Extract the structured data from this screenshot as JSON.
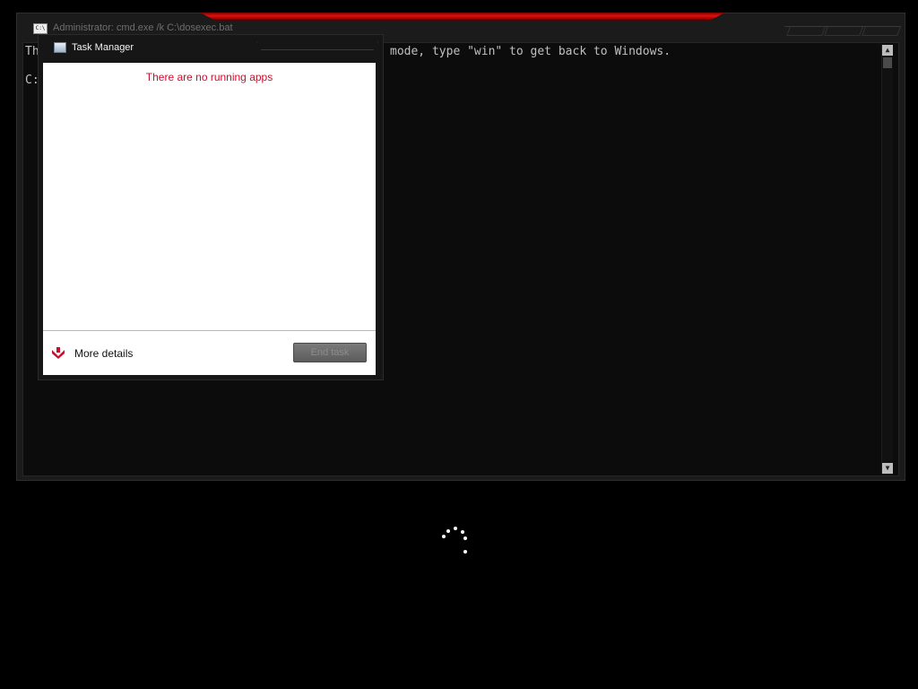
{
  "console": {
    "title": "Administrator: cmd.exe /k C:\\dosexec.bat",
    "icon": "console-icon",
    "line1_left": "Th",
    "line1_right": "mode, type \"win\" to get back to Windows.",
    "line2": "C:"
  },
  "task_manager": {
    "title": "Task Manager",
    "icon": "task-manager-icon",
    "empty_message": "There are no running apps",
    "more_details_label": "More details",
    "end_task_label": "End task",
    "accent_color": "#c8102e"
  },
  "spinner": {
    "icon": "loading-spinner-icon"
  }
}
